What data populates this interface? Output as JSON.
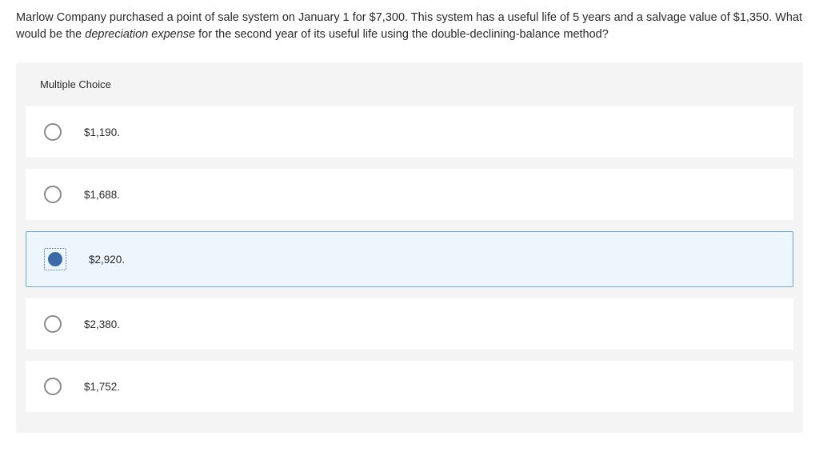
{
  "question": {
    "prefix": "Marlow Company purchased a point of sale system on January 1 for $7,300. This system has a useful life of 5 years and a salvage value of $1,350. What would be the ",
    "emphasis": "depreciation expense",
    "suffix": " for the second year of its useful life using the double-declining-balance method?"
  },
  "mc_header": "Multiple Choice",
  "options": [
    {
      "label": "$1,190.",
      "selected": false
    },
    {
      "label": "$1,688.",
      "selected": false
    },
    {
      "label": "$2,920.",
      "selected": true
    },
    {
      "label": "$2,380.",
      "selected": false
    },
    {
      "label": "$1,752.",
      "selected": false
    }
  ]
}
